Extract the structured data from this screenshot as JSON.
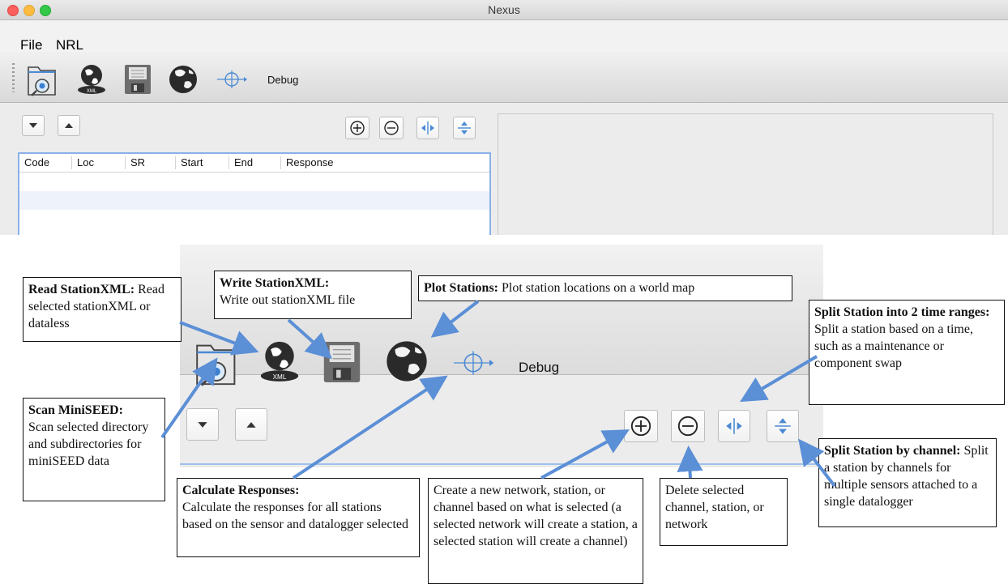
{
  "window": {
    "title": "Nexus"
  },
  "menu": {
    "items": [
      "File",
      "NRL"
    ]
  },
  "toolbar": {
    "buttons": [
      {
        "name": "scan-miniseed",
        "icon": "folder-scan-icon"
      },
      {
        "name": "read-stationxml",
        "icon": "xml-globe-icon"
      },
      {
        "name": "write-stationxml",
        "icon": "floppy-save-icon"
      },
      {
        "name": "plot-stations",
        "icon": "globe-icon"
      },
      {
        "name": "calculate-responses",
        "icon": "crosshair-icon"
      }
    ],
    "debug_label": "Debug"
  },
  "panel": {
    "nav_buttons": [
      "chevron-down-icon",
      "chevron-up-icon"
    ],
    "action_buttons": [
      "plus-circle-icon",
      "minus-circle-icon",
      "split-horizontal-icon",
      "split-vertical-icon"
    ]
  },
  "table": {
    "columns": [
      "Code",
      "Loc",
      "SR",
      "Start",
      "End",
      "Response"
    ],
    "rows": []
  },
  "annotations": {
    "read_stationxml": {
      "title": "Read StationXML:",
      "body": "Read selected stationXML or dataless"
    },
    "write_stationxml": {
      "title": "Write StationXML:",
      "body": "Write out stationXML file"
    },
    "plot_stations": {
      "title": "Plot Stations:",
      "body": "Plot station locations on a world map"
    },
    "split_time": {
      "title": "Split Station into 2 time ranges:",
      "body": "Split a station based on a time, such as a maintenance or component swap"
    },
    "scan_miniseed": {
      "title": "Scan MiniSEED:",
      "body": "Scan selected directory and subdirectories for miniSEED data"
    },
    "split_channel": {
      "title": "Split Station by channel:",
      "body": "Split a station by channels for multiple sensors attached to a single datalogger"
    },
    "calculate_responses": {
      "title": "Calculate Responses:",
      "body": "Calculate the responses for all stations based on the sensor and datalogger selected"
    },
    "create_new": {
      "title": "",
      "body": "Create a new network, station, or channel based on what is selected (a selected network will create a station, a selected station will create a channel)"
    },
    "delete_selected": {
      "title": "",
      "body": "Delete selected channel, station, or network"
    }
  },
  "colors": {
    "accent_blue": "#4a8ad4",
    "arrow_blue": "#5b8fd6",
    "table_border": "#8ab0e8"
  }
}
